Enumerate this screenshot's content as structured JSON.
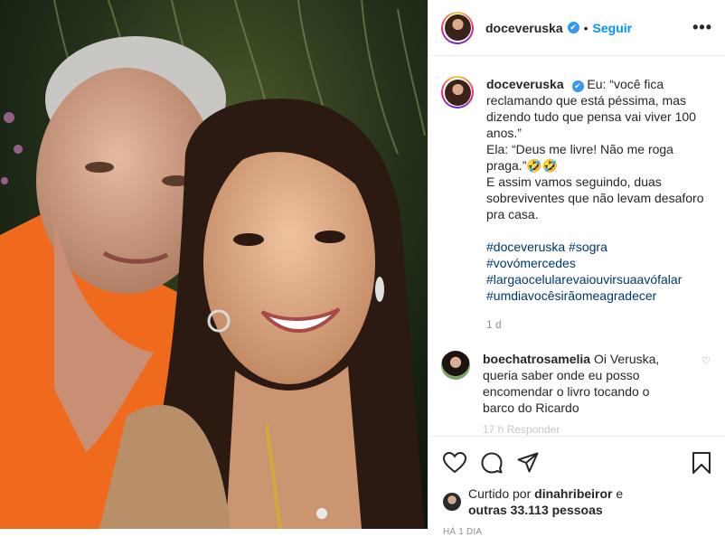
{
  "header": {
    "username": "doceveruska",
    "verified_mark": "✔",
    "separator": "•",
    "follow_label": "Seguir",
    "more_label": "•••"
  },
  "caption": {
    "username": "doceveruska",
    "lines": [
      "Eu: “você fica reclamando que está péssima, mas dizendo tudo que pensa vai viver 100 anos.”",
      "Ela: “Deus me livre! Não me roga praga.”🤣🤣",
      "E assim vamos seguindo, duas sobreviventes que não levam desaforo pra casa."
    ],
    "hashtags": [
      "#doceveruska #sogra",
      "#vovómercedes",
      "#largaocelularevaiouvirsuaavófalar",
      "#umdiavocêsirãomeagradecer"
    ],
    "time": "1 d"
  },
  "comment": {
    "username": "boechatrosamelia",
    "text": "Oi Veruska, queria saber onde eu posso encomendar o livro tocando o barco do Ricardo",
    "heart_icon": "heart-outline-icon",
    "partial_text": "17 h    Responder"
  },
  "likes": {
    "prefix": "Curtido por",
    "user": "dinahribeiror",
    "connector": "e",
    "others": "outras 33.113 pessoas"
  },
  "timestamp": "HÁ 1 DIA",
  "colors": {
    "link": "#0095f6",
    "hashtag": "#00376b",
    "verified": "#3897f0",
    "muted": "#8e8e8e"
  }
}
